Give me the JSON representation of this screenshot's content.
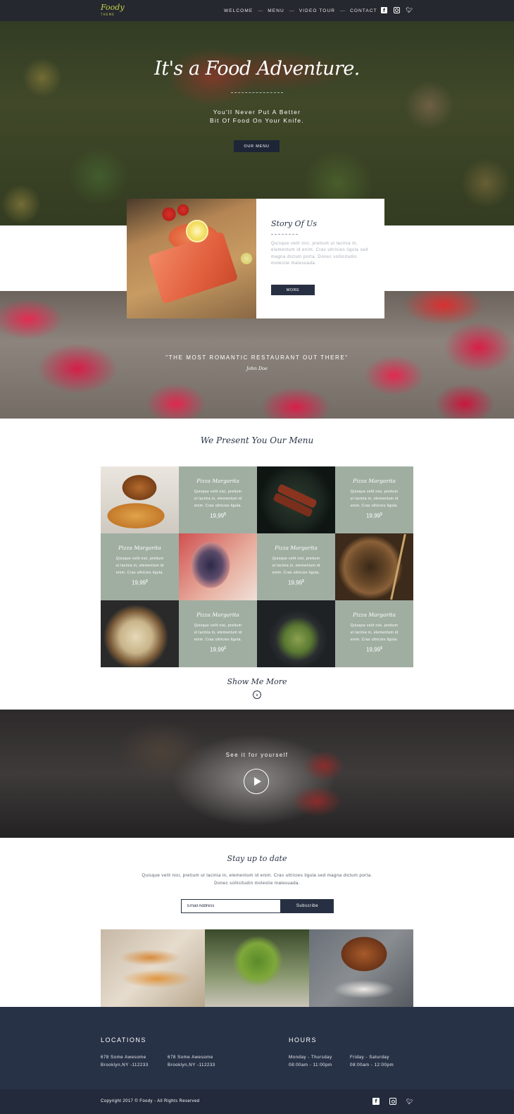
{
  "nav": {
    "logo": "Foody",
    "logo_sub": "THEME",
    "items": [
      "WELCOME",
      "MENU",
      "VIDEO TOUR",
      "CONTACT"
    ],
    "separator": "—"
  },
  "hero": {
    "title": "It's a Food Adventure.",
    "subtitle_line1": "You'll Never Put A Better",
    "subtitle_line2": "Bit Of Food On Your Knife.",
    "button": "OUR MENU"
  },
  "story": {
    "title": "Story Of Us",
    "text": "Quisque velit nisi, pretium ut lacinia in, elementum id enim. Cras ultricies ligula sed magna dictum porta. Donec sollicitudin molestie malesuada.",
    "button": "MORE"
  },
  "quote": {
    "text": "\"THE MOST ROMANTIC RESTAURANT OUT THERE\"",
    "author": "John Doe"
  },
  "menu": {
    "title": "We Present You Our Menu",
    "item": {
      "name": "Pizza Margarita",
      "desc": "Quisque velit nisi, pretium ut lacinia in, elementum id enim. Cras ultricies ligula.",
      "price": "19,99",
      "currency": "$"
    },
    "show_more": "Show Me More"
  },
  "video": {
    "text": "See it for yourself"
  },
  "newsletter": {
    "title": "Stay up to date",
    "text_line1": "Quisque velit nisi, pretium ut lacinia in, elementum id enim. Cras ultricies ligula sed magna dictum porta.",
    "text_line2": "Donec sollicitudin molestie malesuada.",
    "placeholder": "Email Address",
    "button": "Subscribe"
  },
  "footer": {
    "locations_title": "LOCATIONS",
    "loc1_line1": "678 Some Awesome",
    "loc1_line2": "Brooklyn,NY -112233",
    "loc2_line1": "678 Some Awesome",
    "loc2_line2": "Brooklyn,NY -112233",
    "hours_title": "HOURS",
    "hours1_day": "Monday - Thursday",
    "hours1_time": "08:00am - 11:00pm",
    "hours2_day": "Friday - Saturday",
    "hours2_time": "08:00am - 12:00pm",
    "copyright": "Copyright 2017 © Foody - All Rights Reserved"
  },
  "icons": [
    "facebook-icon",
    "instagram-icon",
    "twitter-icon",
    "play-icon",
    "chevron-down-icon"
  ],
  "colors": {
    "navy": "#273043",
    "sage": "#a0aea2",
    "logo_green": "#c8d24a"
  }
}
